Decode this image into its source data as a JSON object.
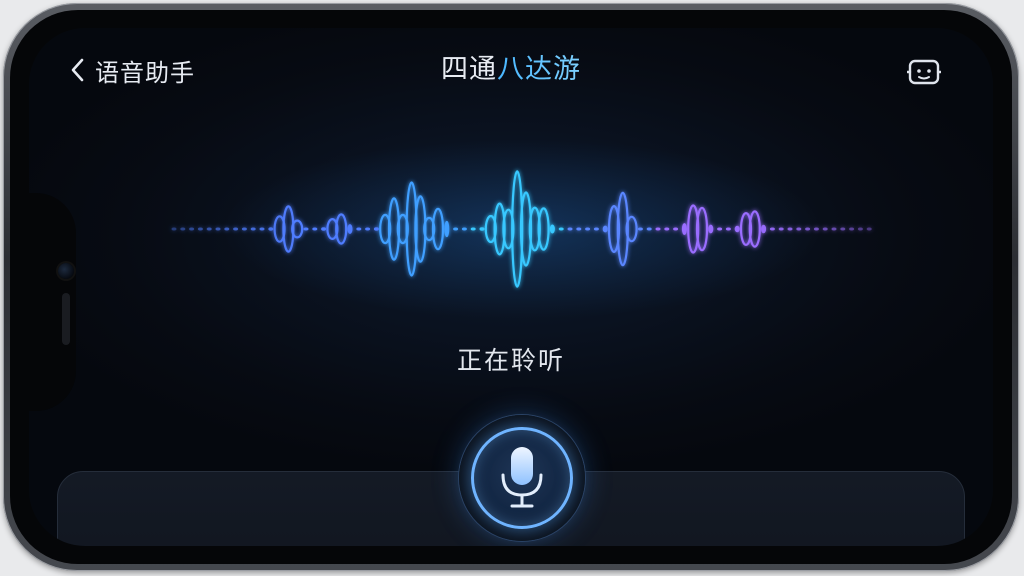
{
  "header": {
    "back_label": "语音助手",
    "title_main": "四通",
    "title_accent": "八达游"
  },
  "status": {
    "text": "正在聆听"
  },
  "icons": {
    "back": "chevron-left-icon",
    "assistant": "robot-face-icon",
    "mic": "microphone-icon"
  },
  "colors": {
    "background": "#070b13",
    "accent": "#48b6ff",
    "wave_cyan": "#39c9ff",
    "wave_blue": "#4f7dff",
    "wave_purple": "#9b6dff",
    "mic_ring": "#6fb4ff"
  },
  "voice_level": 0.85
}
